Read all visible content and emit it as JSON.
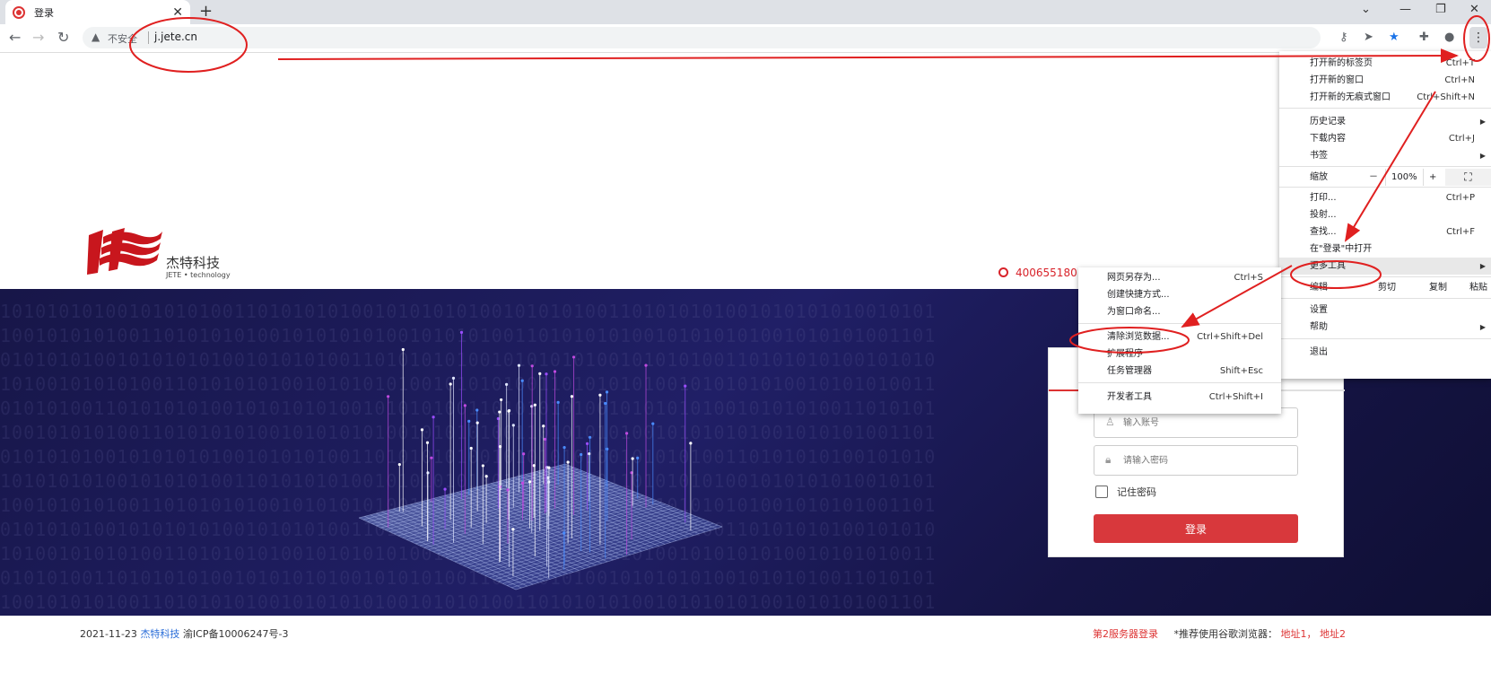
{
  "tab": {
    "title": "登录"
  },
  "omnibox": {
    "security": "不安全",
    "url": "j.jete.cn"
  },
  "page": {
    "logo_cn": "杰特科技",
    "logo_en": "JETE • technology",
    "phone": "400655180",
    "binary_rows": [
      "10101010100101010100110101010100101010101001010101001101010101001010101010010101",
      "10010101010011010101010010101010100101010100110101010100101010101001010101001101",
      "01010101001010101010010101010011010101010010101010100101010100110101010100101010",
      "10100101010100110101010100101010101001010101001101010101001010101010010101010011",
      "01010100110101010100101010101001010101001101010101001010101010010101010011010101",
      "10010101010011010101010010101010100101010100110101010100101010101001010101001101",
      "01010101001010101010010101010011010101010010101010100101010100110101010100101010",
      "10101010100101010100110101010100101010101001010101001101010101001010101010010101",
      "10010101010011010101010010101010100101010100110101010100101010101001010101001101",
      "01010101001010101010010101010011010101010010101010100101010100110101010100101010",
      "10100101010100110101010100101010101001010101001101010101001010101010010101010011",
      "01010100110101010100101010101001010101001101010101001010101010010101010011010101",
      "10010101010011010101010010101010100101010100110101010100101010101001010101001101"
    ]
  },
  "login": {
    "account_placeholder": "输入账号",
    "password_placeholder": "请输入密码",
    "remember_label": "记住密码",
    "submit_label": "登录"
  },
  "footer": {
    "date": "2021-11-23",
    "company": "杰特科技",
    "icp": "渝ICP备10006247号-3",
    "server2": "第2服务器登录",
    "recommend": "*推荐使用谷歌浏览器：",
    "addr1": "地址1，",
    "addr2": "地址2"
  },
  "main_menu": {
    "new_tab": "打开新的标签页",
    "new_tab_sc": "Ctrl+T",
    "new_window": "打开新的窗口",
    "new_window_sc": "Ctrl+N",
    "incognito": "打开新的无痕式窗口",
    "incognito_sc": "Ctrl+Shift+N",
    "history": "历史记录",
    "downloads": "下载内容",
    "downloads_sc": "Ctrl+J",
    "bookmarks": "书签",
    "zoom": "缩放",
    "zoom_minus": "－",
    "zoom_value": "100%",
    "zoom_plus": "+",
    "print": "打印...",
    "print_sc": "Ctrl+P",
    "cast": "投射...",
    "find": "查找...",
    "find_sc": "Ctrl+F",
    "open_in": "在\"登录\"中打开",
    "more_tools": "更多工具",
    "edit": "编辑",
    "cut": "剪切",
    "copy": "复制",
    "paste": "粘贴",
    "settings": "设置",
    "help": "帮助",
    "exit": "退出"
  },
  "sub_menu": {
    "save_as": "网页另存为...",
    "save_as_sc": "Ctrl+S",
    "shortcut": "创建快捷方式...",
    "name_window": "为窗口命名...",
    "clear_data": "清除浏览数据...",
    "clear_data_sc": "Ctrl+Shift+Del",
    "extensions": "扩展程序",
    "task_manager": "任务管理器",
    "task_manager_sc": "Shift+Esc",
    "devtools": "开发者工具",
    "devtools_sc": "Ctrl+Shift+I"
  },
  "colors": {
    "accent_red": "#d8232a",
    "hero_bg": "#1c1b5c",
    "annotation_red": "#e02020"
  },
  "icons": [
    "back-icon",
    "forward-icon",
    "reload-icon",
    "warning-icon",
    "key-icon",
    "send-icon",
    "star-icon",
    "puzzle-icon",
    "profile-icon",
    "kebab-menu-icon"
  ]
}
